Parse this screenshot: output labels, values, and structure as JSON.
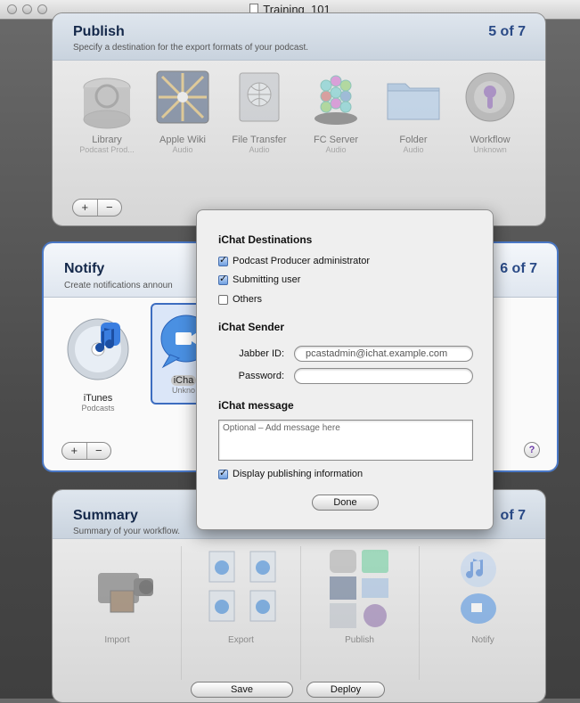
{
  "window": {
    "title": "Training_101"
  },
  "publish": {
    "title": "Publish",
    "subtitle": "Specify a destination for the export formats of your podcast.",
    "step": "5 of 7",
    "items": [
      {
        "label": "Library",
        "sub": "Podcast Prod...",
        "icon": "library-icon"
      },
      {
        "label": "Apple Wiki",
        "sub": "Audio",
        "icon": "wiki-icon"
      },
      {
        "label": "File Transfer",
        "sub": "Audio",
        "icon": "file-transfer-icon"
      },
      {
        "label": "FC Server",
        "sub": "Audio",
        "icon": "fc-server-icon"
      },
      {
        "label": "Folder",
        "sub": "Audio",
        "icon": "folder-icon"
      },
      {
        "label": "Workflow",
        "sub": "Unknown",
        "icon": "workflow-icon"
      }
    ]
  },
  "notify": {
    "title": "Notify",
    "subtitle": "Create notifications announ",
    "step": "6 of 7",
    "items": [
      {
        "label": "iTunes",
        "sub": "Podcasts",
        "icon": "itunes-icon"
      },
      {
        "label": "iCha",
        "sub": "Unkno",
        "icon": "ichat-icon"
      }
    ],
    "help": "?"
  },
  "summary": {
    "title": "Summary",
    "subtitle": "Summary of your workflow.",
    "step": "of 7",
    "columns": [
      "Import",
      "Export",
      "Publish",
      "Notify"
    ]
  },
  "dialog": {
    "destinations_heading": "iChat Destinations",
    "destinations": [
      {
        "label": "Podcast Producer administrator",
        "checked": true
      },
      {
        "label": "Submitting user",
        "checked": true
      },
      {
        "label": "Others",
        "checked": false
      }
    ],
    "sender_heading": "iChat Sender",
    "jabber_label": "Jabber ID:",
    "jabber_value": "pcastadmin@ichat.example.com",
    "password_label": "Password:",
    "password_value": "",
    "message_heading": "iChat message",
    "message_placeholder": "Optional – Add message here",
    "display_info_label": "Display publishing information",
    "display_info_checked": true,
    "done_label": "Done"
  },
  "footer": {
    "save_label": "Save",
    "deploy_label": "Deploy"
  },
  "buttons": {
    "plus": "+",
    "minus": "−"
  }
}
